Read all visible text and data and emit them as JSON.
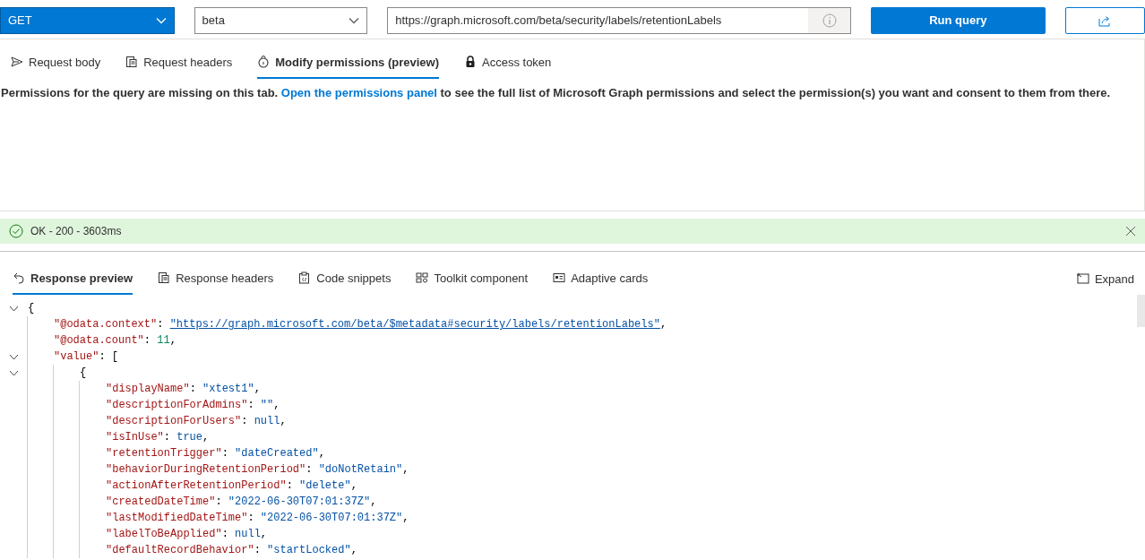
{
  "toolbar": {
    "method": "GET",
    "version": "beta",
    "url": "https://graph.microsoft.com/beta/security/labels/retentionLabels",
    "run_button": "Run query"
  },
  "request_tabs": [
    {
      "label": "Request body",
      "selected": false
    },
    {
      "label": "Request headers",
      "selected": false
    },
    {
      "label": "Modify permissions (preview)",
      "selected": true
    },
    {
      "label": "Access token",
      "selected": false
    }
  ],
  "permissions_message": {
    "before": "Permissions for the query are missing on this tab. ",
    "link": "Open the permissions panel",
    "after": " to see the full list of Microsoft Graph permissions and select the permission(s) you want and consent to them from there."
  },
  "status_bar": {
    "text": "OK - 200 - 3603ms"
  },
  "response_tabs": [
    {
      "label": "Response preview",
      "selected": true
    },
    {
      "label": "Response headers",
      "selected": false
    },
    {
      "label": "Code snippets",
      "selected": false
    },
    {
      "label": "Toolkit component",
      "selected": false
    },
    {
      "label": "Adaptive cards",
      "selected": false
    }
  ],
  "expand_button": "Expand",
  "response_code": [
    {
      "expanded": true,
      "parts": [
        {
          "kind": "punct",
          "text": "{"
        }
      ],
      "children": [
        {
          "parts": [
            {
              "kind": "key",
              "text": "\"@odata.context\""
            },
            {
              "kind": "punct",
              "text": ": "
            },
            {
              "kind": "link",
              "text": "\"https://graph.microsoft.com/beta/$metadata#security/labels/retentionLabels\""
            },
            {
              "kind": "punct",
              "text": ","
            }
          ]
        },
        {
          "parts": [
            {
              "kind": "key",
              "text": "\"@odata.count\""
            },
            {
              "kind": "punct",
              "text": ": "
            },
            {
              "kind": "number",
              "text": "11"
            },
            {
              "kind": "punct",
              "text": ","
            }
          ]
        },
        {
          "expanded": true,
          "parts": [
            {
              "kind": "key",
              "text": "\"value\""
            },
            {
              "kind": "punct",
              "text": ": ["
            }
          ],
          "children": [
            {
              "expanded": true,
              "parts": [
                {
                  "kind": "punct",
                  "text": "{"
                }
              ],
              "children": [
                {
                  "parts": [
                    {
                      "kind": "key",
                      "text": "\"displayName\""
                    },
                    {
                      "kind": "punct",
                      "text": ": "
                    },
                    {
                      "kind": "string",
                      "text": "\"xtest1\""
                    },
                    {
                      "kind": "punct",
                      "text": ","
                    }
                  ]
                },
                {
                  "parts": [
                    {
                      "kind": "key",
                      "text": "\"descriptionForAdmins\""
                    },
                    {
                      "kind": "punct",
                      "text": ": "
                    },
                    {
                      "kind": "string",
                      "text": "\"\""
                    },
                    {
                      "kind": "punct",
                      "text": ","
                    }
                  ]
                },
                {
                  "parts": [
                    {
                      "kind": "key",
                      "text": "\"descriptionForUsers\""
                    },
                    {
                      "kind": "punct",
                      "text": ": "
                    },
                    {
                      "kind": "keyword",
                      "text": "null"
                    },
                    {
                      "kind": "punct",
                      "text": ","
                    }
                  ]
                },
                {
                  "parts": [
                    {
                      "kind": "key",
                      "text": "\"isInUse\""
                    },
                    {
                      "kind": "punct",
                      "text": ": "
                    },
                    {
                      "kind": "keyword",
                      "text": "true"
                    },
                    {
                      "kind": "punct",
                      "text": ","
                    }
                  ]
                },
                {
                  "parts": [
                    {
                      "kind": "key",
                      "text": "\"retentionTrigger\""
                    },
                    {
                      "kind": "punct",
                      "text": ": "
                    },
                    {
                      "kind": "string",
                      "text": "\"dateCreated\""
                    },
                    {
                      "kind": "punct",
                      "text": ","
                    }
                  ]
                },
                {
                  "parts": [
                    {
                      "kind": "key",
                      "text": "\"behaviorDuringRetentionPeriod\""
                    },
                    {
                      "kind": "punct",
                      "text": ": "
                    },
                    {
                      "kind": "string",
                      "text": "\"doNotRetain\""
                    },
                    {
                      "kind": "punct",
                      "text": ","
                    }
                  ]
                },
                {
                  "parts": [
                    {
                      "kind": "key",
                      "text": "\"actionAfterRetentionPeriod\""
                    },
                    {
                      "kind": "punct",
                      "text": ": "
                    },
                    {
                      "kind": "string",
                      "text": "\"delete\""
                    },
                    {
                      "kind": "punct",
                      "text": ","
                    }
                  ]
                },
                {
                  "parts": [
                    {
                      "kind": "key",
                      "text": "\"createdDateTime\""
                    },
                    {
                      "kind": "punct",
                      "text": ": "
                    },
                    {
                      "kind": "string",
                      "text": "\"2022-06-30T07:01:37Z\""
                    },
                    {
                      "kind": "punct",
                      "text": ","
                    }
                  ]
                },
                {
                  "parts": [
                    {
                      "kind": "key",
                      "text": "\"lastModifiedDateTime\""
                    },
                    {
                      "kind": "punct",
                      "text": ": "
                    },
                    {
                      "kind": "string",
                      "text": "\"2022-06-30T07:01:37Z\""
                    },
                    {
                      "kind": "punct",
                      "text": ","
                    }
                  ]
                },
                {
                  "parts": [
                    {
                      "kind": "key",
                      "text": "\"labelToBeApplied\""
                    },
                    {
                      "kind": "punct",
                      "text": ": "
                    },
                    {
                      "kind": "keyword",
                      "text": "null"
                    },
                    {
                      "kind": "punct",
                      "text": ","
                    }
                  ]
                },
                {
                  "parts": [
                    {
                      "kind": "key",
                      "text": "\"defaultRecordBehavior\""
                    },
                    {
                      "kind": "punct",
                      "text": ": "
                    },
                    {
                      "kind": "string",
                      "text": "\"startLocked\""
                    },
                    {
                      "kind": "punct",
                      "text": ","
                    }
                  ]
                }
              ]
            }
          ]
        }
      ]
    }
  ]
}
